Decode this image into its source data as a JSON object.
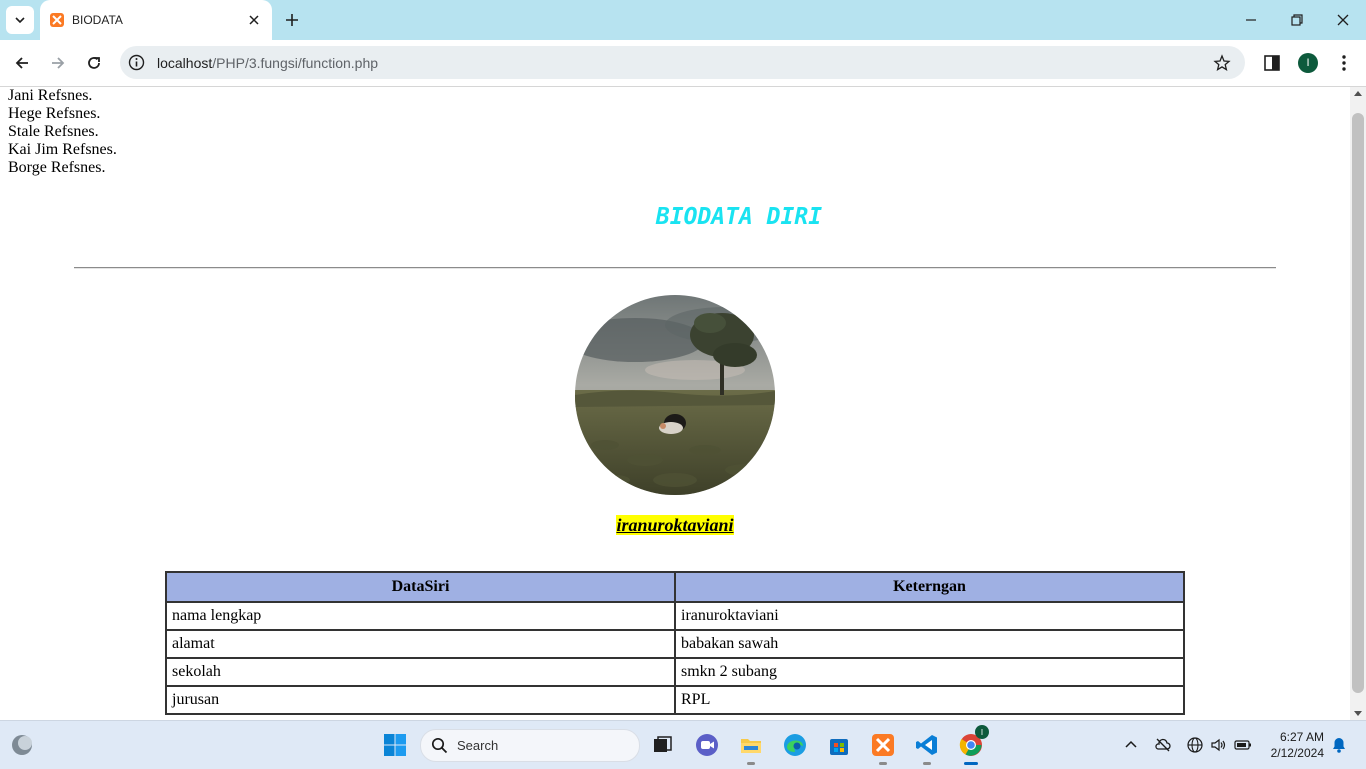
{
  "browser": {
    "tab_title": "BIODATA",
    "url_host": "localhost",
    "url_path": "/PHP/3.fungsi/function.php",
    "profile_initial": "I"
  },
  "page": {
    "names": [
      "Jani Refsnes.",
      "Hege Refsnes.",
      "Stale Refsnes.",
      "Kai Jim Refsnes.",
      "Borge Refsnes."
    ],
    "heading": "BIODATA DIRI",
    "heading_color": "#19e3f1",
    "username": "iranuroktaviani",
    "table": {
      "headers": [
        "DataSiri",
        "Keterngan"
      ],
      "header_bg": "#9fb0e3",
      "rows": [
        [
          "nama lengkap",
          "iranuroktaviani"
        ],
        [
          "alamat",
          "babakan sawah"
        ],
        [
          "sekolah",
          "smkn 2 subang"
        ],
        [
          "jurusan",
          "RPL"
        ]
      ]
    }
  },
  "taskbar": {
    "search_label": "Search",
    "time": "6:27 AM",
    "date": "2/12/2024",
    "chrome_badge": "I"
  }
}
